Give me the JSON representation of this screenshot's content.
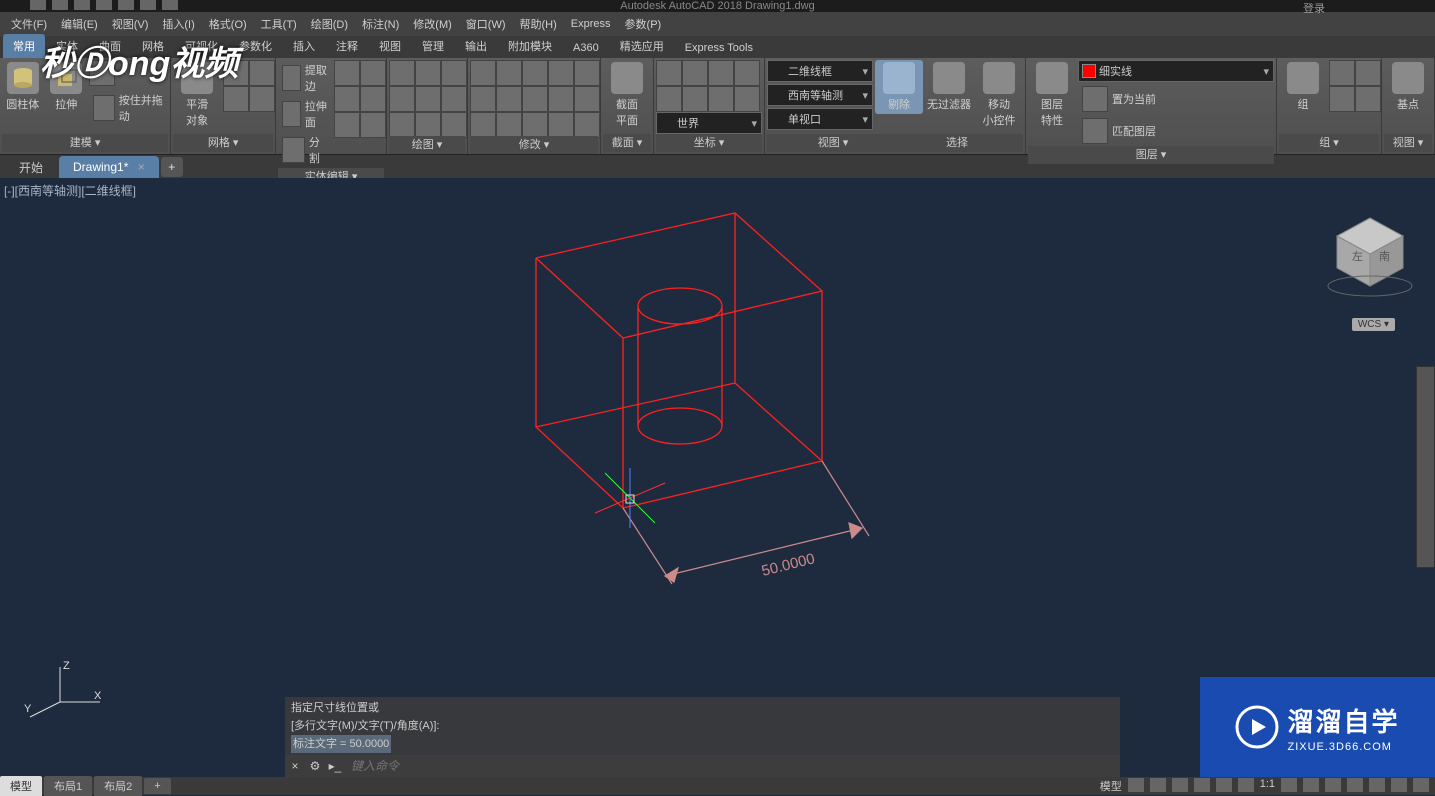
{
  "app": {
    "title": "Autodesk AutoCAD 2018   Drawing1.dwg",
    "login": "登录"
  },
  "menus": [
    "文件(F)",
    "编辑(E)",
    "视图(V)",
    "插入(I)",
    "格式(O)",
    "工具(T)",
    "绘图(D)",
    "标注(N)",
    "修改(M)",
    "窗口(W)",
    "帮助(H)",
    "Express",
    "参数(P)"
  ],
  "ribbon_tabs": [
    "常用",
    "实体",
    "曲面",
    "网格",
    "可视化",
    "参数化",
    "插入",
    "注释",
    "视图",
    "管理",
    "输出",
    "附加模块",
    "A360",
    "精选应用",
    "Express Tools"
  ],
  "ribbon_active": 0,
  "panels": {
    "create": {
      "label": "建模 ▾",
      "cyl": "圆柱体",
      "extr": "拉伸",
      "pressdrag": "按住并拖动"
    },
    "mesh": {
      "label": "网格 ▾",
      "smooth": "平滑\n对象"
    },
    "solid": {
      "label": "实体编辑 ▾",
      "extract": "提取边",
      "loft": "拉伸面",
      "split": "分割"
    },
    "draw": {
      "label": "绘图 ▾"
    },
    "modify": {
      "label": "修改 ▾"
    },
    "section": {
      "label": "截面 ▾",
      "plane": "截面\n平面"
    },
    "coord": {
      "label": "坐标 ▾",
      "world": "世界"
    },
    "view": {
      "label": "视图 ▾",
      "style": "二维线框",
      "vp": "西南等轴测",
      "viewport": "单视口"
    },
    "select": {
      "label": "选择",
      "filteroff": "无过滤器",
      "erase": "剔除",
      "gizmo": "移动\n小控件"
    },
    "layer": {
      "label": "图层 ▾",
      "props": "图层\n特性",
      "combo": "细实线",
      "setcur": "置为当前",
      "match": "匹配图层"
    },
    "group": {
      "label": "组 ▾",
      "g": "组"
    },
    "base": {
      "label": "视图 ▾",
      "b": "基点"
    }
  },
  "doc_tabs": {
    "home": "开始",
    "active": "Drawing1*"
  },
  "viewport_label": "[-][西南等轴测][二维线框]",
  "wcs": "WCS ▾",
  "dimension": "50.0000",
  "cmd_history": [
    "指定尺寸线位置或",
    "[多行文字(M)/文字(T)/角度(A)]:",
    "标注文字 = 50.0000"
  ],
  "cmd_placeholder": "键入命令",
  "layout_tabs": [
    "模型",
    "布局1",
    "布局2"
  ],
  "status_model": "模型",
  "status_scale": "1:1",
  "ucs": {
    "x": "X",
    "y": "Y",
    "z": "Z"
  },
  "watermark_video": "秒Ⓓong视频",
  "watermark_zixue": {
    "main": "溜溜自学",
    "sub": "ZIXUE.3D66.COM"
  }
}
